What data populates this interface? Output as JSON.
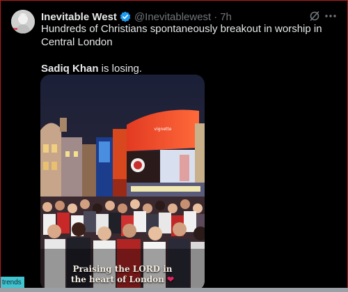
{
  "tweet": {
    "author_name": "Inevitable West",
    "handle": "@Inevitablewest",
    "separator": "·",
    "time": "7h",
    "text_line1": "Hundreds of Christians spontaneously breakout in worship in Central London",
    "text_line2_bold": "Sadiq Khan",
    "text_line2_rest": " is losing.",
    "media_caption_line1": "Praising the LORD in",
    "media_caption_line2": "the heart of London",
    "media_caption_heart": "❤"
  },
  "icons": {
    "verified": "verified-badge-icon",
    "grok": "grok-icon",
    "more": "more-icon"
  },
  "colors": {
    "background": "#000000",
    "text_primary": "#e7e9ea",
    "text_secondary": "#71767b",
    "verified_blue": "#1d9bf0",
    "frame_border": "#c21a1a",
    "trends_tab": "#40c4d0"
  },
  "overlay": {
    "trends_label": "trends"
  }
}
